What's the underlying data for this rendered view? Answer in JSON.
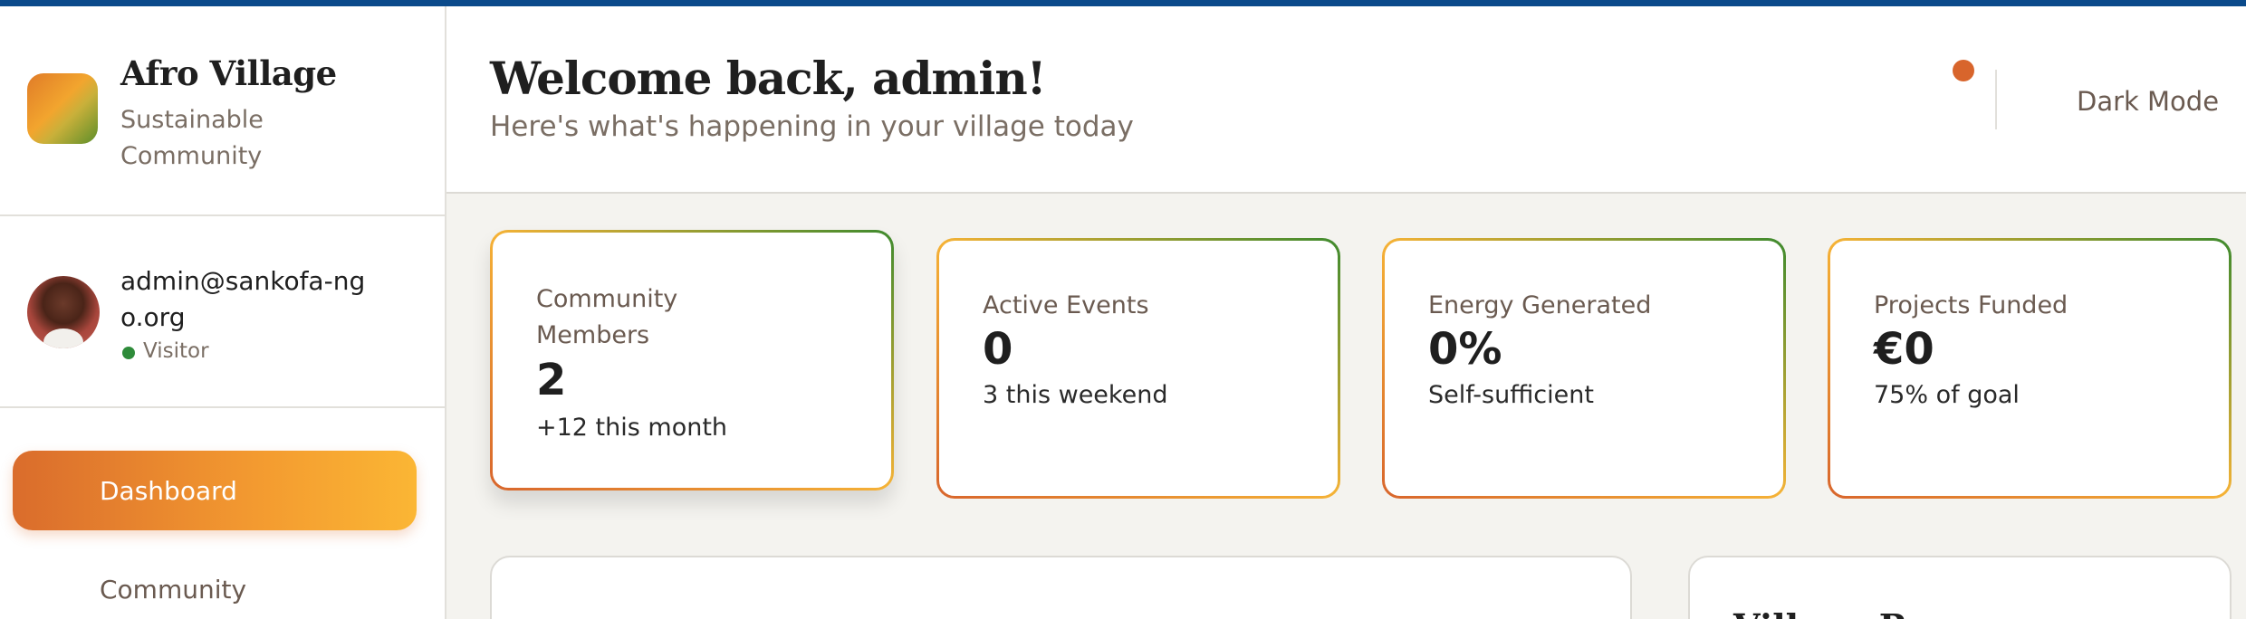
{
  "brand": {
    "title": "Afro Village",
    "subtitle": "Sustainable Community",
    "logo_gradient": [
      "#e07b28",
      "#f2a52e",
      "#5c8e2a"
    ]
  },
  "user": {
    "email": "admin@sankofa-ngo.org",
    "role": "Visitor",
    "status_color": "#2e8b3a"
  },
  "nav": {
    "items": [
      {
        "label": "Dashboard",
        "active": true
      },
      {
        "label": "Community",
        "active": false
      }
    ]
  },
  "header": {
    "title": "Welcome back, admin!",
    "subtitle": "Here's what's happening in your village today",
    "dark_mode_label": "Dark Mode",
    "notification_color": "#d8652c"
  },
  "stats": [
    {
      "label": "Community Members",
      "value": "2",
      "note": "+12 this month"
    },
    {
      "label": "Active Events",
      "value": "0",
      "note": "3 this weekend"
    },
    {
      "label": "Energy Generated",
      "value": "0%",
      "note": "Self-sufficient"
    },
    {
      "label": "Projects Funded",
      "value": "€0",
      "note": "75% of goal"
    }
  ],
  "panels": {
    "side_title": "Village Resources"
  },
  "colors": {
    "accent_orange": "#da6c2c",
    "accent_yellow": "#fbb634",
    "accent_green": "#3e8a2e",
    "top_strip": "#0b4a8b"
  }
}
